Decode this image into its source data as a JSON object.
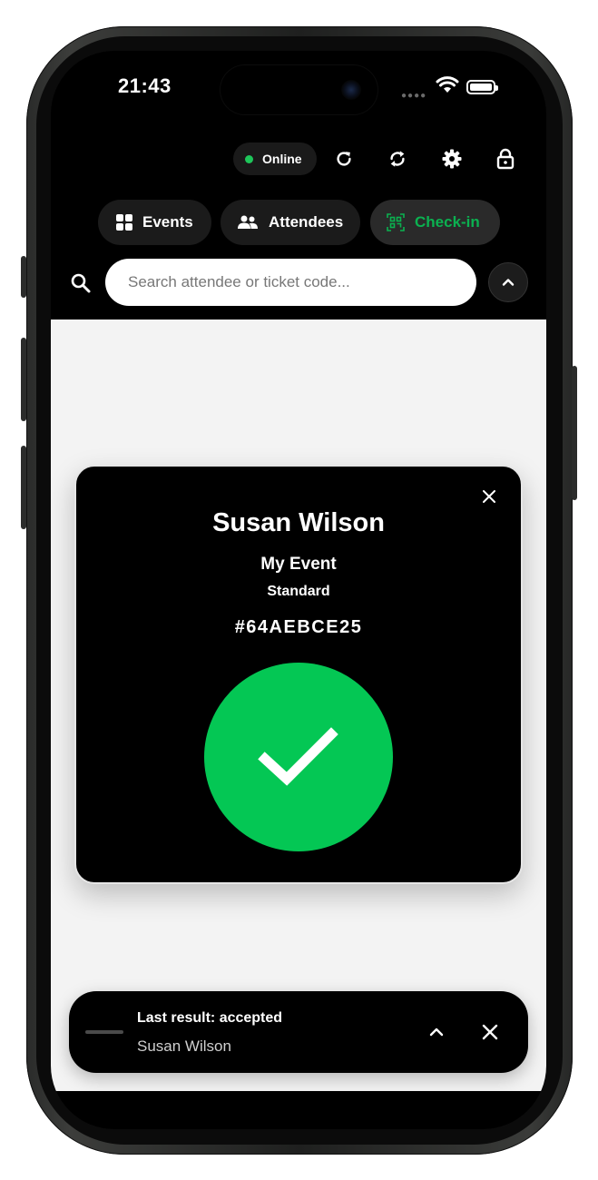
{
  "status_bar": {
    "time": "21:43"
  },
  "toolbar": {
    "connection_label": "Online",
    "connection_color": "#1ec65a",
    "icons": [
      "refresh-icon",
      "sync-icon",
      "gear-icon",
      "lock-icon"
    ]
  },
  "nav": {
    "tabs": [
      {
        "label": "Events",
        "icon": "grid-icon",
        "active": false
      },
      {
        "label": "Attendees",
        "icon": "people-icon",
        "active": false
      },
      {
        "label": "Check-in",
        "icon": "qr-scan-icon",
        "active": true
      }
    ],
    "active_color": "#0bb150"
  },
  "search": {
    "placeholder": "Search attendee or ticket code...",
    "value": ""
  },
  "result_card": {
    "name": "Susan Wilson",
    "event": "My Event",
    "ticket_type": "Standard",
    "ticket_code": "#64AEBCE25",
    "status_icon": "check-icon",
    "status_color": "#04c754"
  },
  "last_result": {
    "title": "Last result: accepted",
    "name": "Susan Wilson"
  }
}
